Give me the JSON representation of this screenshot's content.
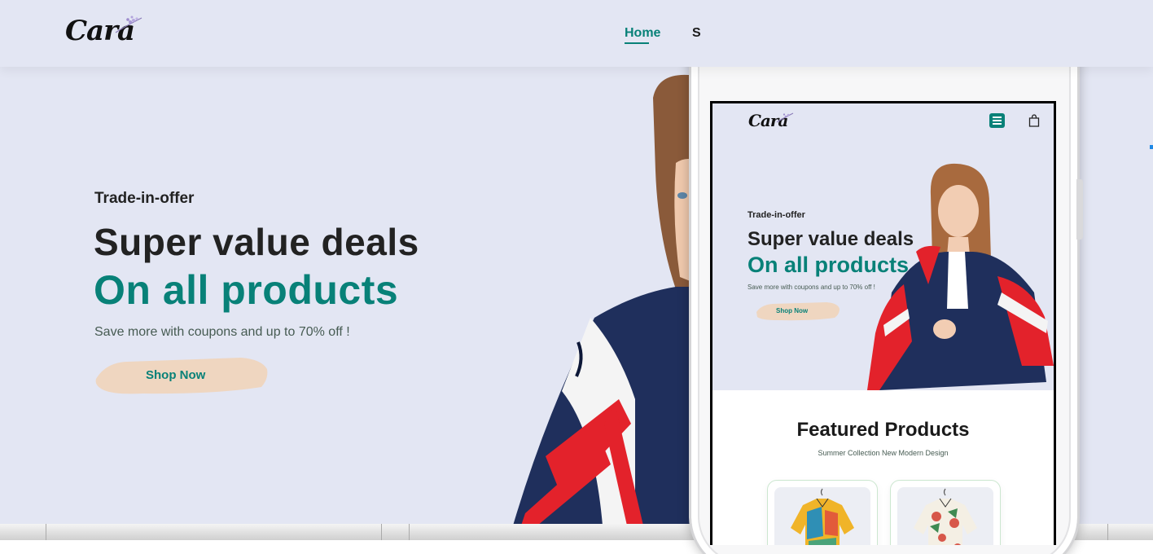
{
  "brand": {
    "logo_text": "Cara"
  },
  "nav": {
    "home_label": "Home",
    "shop_label_partial": "S"
  },
  "hero": {
    "eyebrow": "Trade-in-offer",
    "headline": "Super value deals",
    "headline_accent": "On all products",
    "description": "Save more with coupons and up to 70% off !",
    "cta_label": "Shop Now"
  },
  "mobile": {
    "logo_text": "Cara",
    "menu_icon": "menu-icon",
    "bag_icon": "bag-icon",
    "hero": {
      "eyebrow": "Trade-in-offer",
      "headline": "Super value deals",
      "headline_accent": "On all products",
      "description": "Save more with coupons and up to 70% off !",
      "cta_label": "Shop Now"
    },
    "featured": {
      "title": "Featured Products",
      "subtitle": "Summer Collection New Modern Design"
    }
  },
  "colors": {
    "accent": "#088178",
    "hero_bg": "#e3e6f3",
    "cta_brush": "#efd6c0",
    "jacket_navy": "#1f2f5c",
    "jacket_red": "#e3222b"
  }
}
